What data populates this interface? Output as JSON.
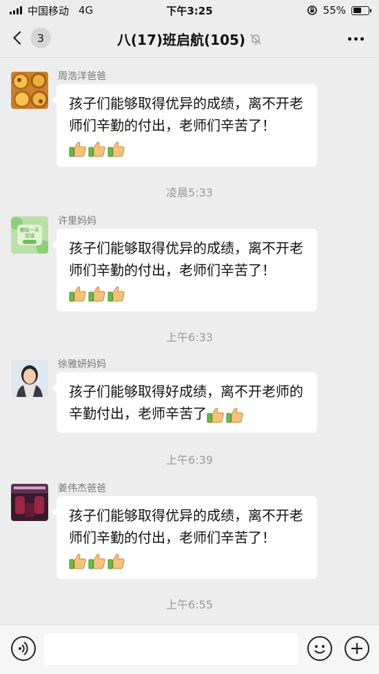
{
  "status_bar": {
    "carrier": "中国移动",
    "network": "4G",
    "time": "下午3:25",
    "battery": "55%",
    "battery_level": 0.55,
    "icons": [
      "signal-icon",
      "rotation-lock-icon",
      "battery-icon"
    ]
  },
  "header": {
    "unread_count": "3",
    "title": "八(17)班启航(105)",
    "icons": [
      "back-chevron-icon",
      "mute-bell-icon",
      "more-icon"
    ]
  },
  "messages": [
    {
      "sender": "周浩洋爸爸",
      "avatar": "egg-tarts-avatar",
      "text": "孩子们能够取得优异的成绩，离不开老师们辛勤的付出，老师们辛苦了！",
      "emoji": [
        "thumbs-up",
        "thumbs-up",
        "thumbs-up"
      ]
    },
    {
      "sender": "许里妈妈",
      "avatar": "green-card-avatar",
      "avatar_text": "都给一天加油",
      "text": "孩子们能够取得优异的成绩，离不开老师们辛勤的付出，老师们辛苦了！",
      "emoji": [
        "thumbs-up",
        "thumbs-up",
        "thumbs-up"
      ]
    },
    {
      "sender": "徐雅妍妈妈",
      "avatar": "portrait-avatar",
      "text": "孩子们能够取得好成绩，离不开老师的辛勤付出，老师辛苦了",
      "emoji": [
        "thumbs-up",
        "thumbs-up"
      ]
    },
    {
      "sender": "姜伟杰爸爸",
      "avatar": "car-interior-avatar",
      "text": "孩子们能够取得优异的成绩，离不开老师们辛勤的付出，老师们辛苦了！",
      "emoji": [
        "thumbs-up",
        "thumbs-up",
        "thumbs-up"
      ]
    }
  ],
  "timestamps": [
    "凌晨5:33",
    "上午6:33",
    "上午6:39",
    "上午6:55"
  ],
  "input_bar": {
    "icons": [
      "voice-icon",
      "emoji-icon",
      "plus-icon"
    ]
  },
  "colors": {
    "background": "#ededed",
    "bubble": "#ffffff",
    "timestamp": "#9a9a9a",
    "sender": "#777777"
  }
}
